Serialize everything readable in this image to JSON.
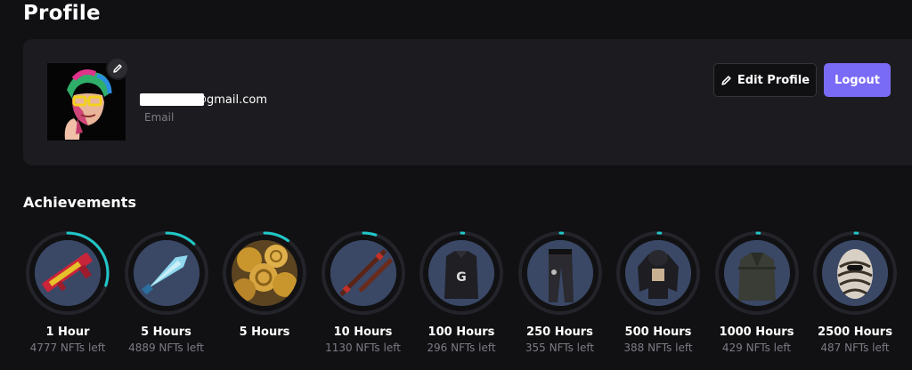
{
  "page": {
    "title": "Profile"
  },
  "profile": {
    "email_visible": "@gmail.com",
    "email_label": "Email",
    "edit_button": "Edit Profile",
    "logout_button": "Logout"
  },
  "achievements": {
    "title": "Achievements",
    "items": [
      {
        "label": "1 Hour",
        "sub": "4777 NFTs left",
        "progress": 0.3,
        "item": "rifle"
      },
      {
        "label": "5 Hours",
        "sub": "4889 NFTs left",
        "progress": 0.12,
        "item": "ice-sword"
      },
      {
        "label": "5 Hours",
        "sub": "",
        "progress": 0.1,
        "item": "gold-coins"
      },
      {
        "label": "10 Hours",
        "sub": "1130 NFTs left",
        "progress": 0.05,
        "item": "staff"
      },
      {
        "label": "100 Hours",
        "sub": "296 NFTs left",
        "progress": 0.01,
        "item": "vest"
      },
      {
        "label": "250 Hours",
        "sub": "355 NFTs left",
        "progress": 0.01,
        "item": "pants"
      },
      {
        "label": "500 Hours",
        "sub": "388 NFTs left",
        "progress": 0.01,
        "item": "hoodie"
      },
      {
        "label": "1000 Hours",
        "sub": "429 NFTs left",
        "progress": 0.01,
        "item": "coat"
      },
      {
        "label": "2500 Hours",
        "sub": "487 NFTs left",
        "progress": 0.01,
        "item": "mask"
      }
    ]
  },
  "colors": {
    "accent": "#7a6bf6",
    "progress_ring": "#1fc8c8",
    "background": "#111113",
    "card": "#1c1c20",
    "muted_text": "#7b7b85"
  }
}
